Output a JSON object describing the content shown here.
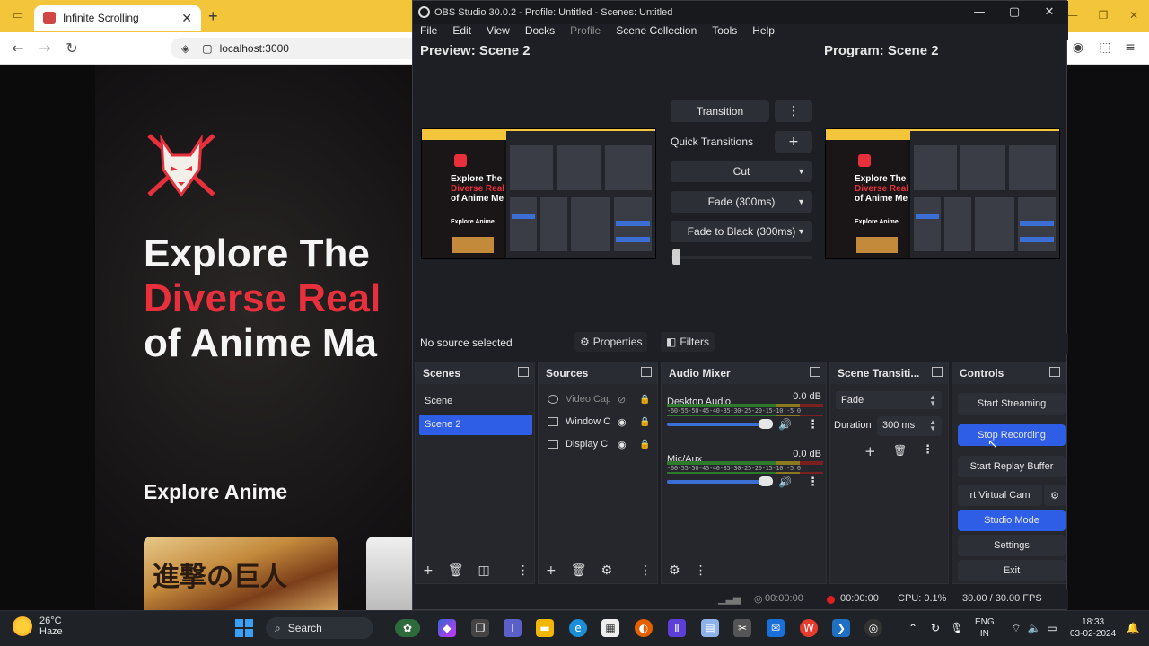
{
  "browser": {
    "tab_title": "Infinite Scrolling",
    "new_tab": "+",
    "url": "localhost:3000"
  },
  "site": {
    "hero_line1": "Explore The",
    "hero_line2": "Diverse Real",
    "hero_line3": "of Anime Ma",
    "section_title": "Explore Anime",
    "card_kanji": "進撃の巨人",
    "colors": {
      "accent": "#e8303c",
      "background": "#151314"
    }
  },
  "obs": {
    "window_title": "OBS Studio 30.0.2 - Profile: Untitled - Scenes: Untitled",
    "menu": [
      "File",
      "Edit",
      "View",
      "Docks",
      "Profile",
      "Scene Collection",
      "Tools",
      "Help"
    ],
    "preview_label": "Preview: Scene 2",
    "program_label": "Program: Scene 2",
    "preview_thumb": {
      "line1": "Explore The",
      "line2": "Diverse Real",
      "line3": "of Anime Me",
      "line4": "Explore Anime"
    },
    "transitions": {
      "transition_btn": "Transition",
      "quick_label": "Quick Transitions",
      "items": [
        "Cut",
        "Fade (300ms)",
        "Fade to Black (300ms)"
      ]
    },
    "context": {
      "status": "No source selected",
      "properties": "Properties",
      "filters": "Filters"
    },
    "scenes": {
      "title": "Scenes",
      "items": [
        "Scene",
        "Scene 2"
      ],
      "selected": "Scene 2"
    },
    "sources": {
      "title": "Sources",
      "items": [
        "Video Cap",
        "Window C",
        "Display C"
      ]
    },
    "mixer": {
      "title": "Audio Mixer",
      "ticks": "-60-55-50-45-40-35-30-25-20-15-10 -5  0",
      "channels": [
        {
          "name": "Desktop Audio",
          "db": "0.0 dB"
        },
        {
          "name": "Mic/Aux",
          "db": "0.0 dB"
        }
      ]
    },
    "scene_transitions": {
      "title": "Scene Transiti...",
      "type": "Fade",
      "duration_label": "Duration",
      "duration_value": "300 ms"
    },
    "controls": {
      "title": "Controls",
      "start_streaming": "Start Streaming",
      "stop_recording": "Stop Recording",
      "start_replay": "Start Replay Buffer",
      "virtual_cam": "rt Virtual Cam",
      "studio_mode": "Studio Mode",
      "settings": "Settings",
      "exit": "Exit"
    },
    "status_bar": {
      "stream_time": "00:00:00",
      "rec_time": "00:00:00",
      "cpu": "CPU: 0.1%",
      "fps": "30.00 / 30.00 FPS"
    },
    "colors": {
      "accent_blue": "#2f5ee6",
      "panel": "#25272d",
      "rec_red": "#e02020"
    }
  },
  "taskbar": {
    "weather_temp": "26°C",
    "weather_desc": "Haze",
    "search": "Search",
    "lang": "ENG",
    "region": "IN",
    "time": "18:33",
    "date": "03-02-2024"
  }
}
